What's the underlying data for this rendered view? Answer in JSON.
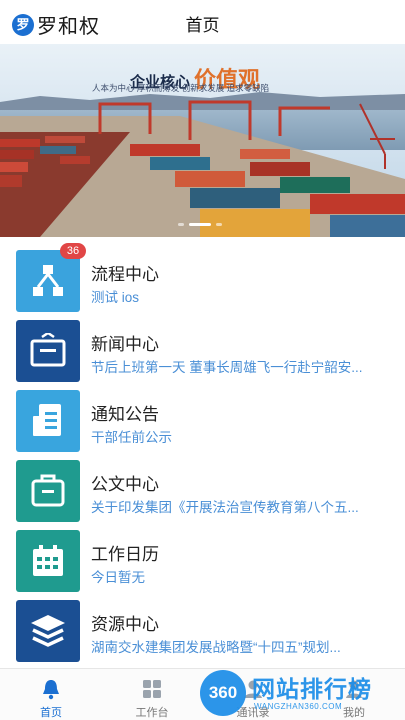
{
  "app": {
    "logo_mark": "罗",
    "logo_text": "罗和权",
    "title": "首页"
  },
  "banner": {
    "slogan_main": "企业核心",
    "slogan_highlight": "价值观",
    "slogan_sub": "人本为中心  厚积而薄发  创新求发展  追求零缺陷",
    "slide_count": 3,
    "active_slide": 2
  },
  "modules": [
    {
      "title": "流程中心",
      "subtitle": "测试 ios",
      "badge": "36",
      "icon": "flow-chart-icon",
      "color": "#3aa3dd"
    },
    {
      "title": "新闻中心",
      "subtitle": "节后上班第一天 董事长周雄飞一行赴宁韶安...",
      "badge": "",
      "icon": "news-briefcase-icon",
      "color": "#1b4f93"
    },
    {
      "title": "通知公告",
      "subtitle": "干部任前公示",
      "badge": "",
      "icon": "notice-document-icon",
      "color": "#39a5de"
    },
    {
      "title": "公文中心",
      "subtitle": "关于印发集团《开展法治宣传教育第八个五...",
      "badge": "",
      "icon": "document-bag-icon",
      "color": "#1f9b8f"
    },
    {
      "title": "工作日历",
      "subtitle": "今日暂无",
      "badge": "",
      "icon": "calendar-icon",
      "color": "#1f9b8f"
    },
    {
      "title": "资源中心",
      "subtitle": "湖南交水建集团发展战略暨“十四五”规划...",
      "badge": "",
      "icon": "layers-icon",
      "color": "#1b4f93"
    }
  ],
  "bottom_nav": [
    {
      "label": "首页",
      "icon": "bell-icon",
      "active": true
    },
    {
      "label": "工作台",
      "icon": "grid-icon",
      "active": false
    },
    {
      "label": "通讯录",
      "icon": "contacts-icon",
      "active": false
    },
    {
      "label": "我的",
      "icon": "user-icon",
      "active": false
    }
  ],
  "watermark": {
    "badge": "360",
    "text": "网站排行榜",
    "url": "WANGZHAN360.COM"
  }
}
